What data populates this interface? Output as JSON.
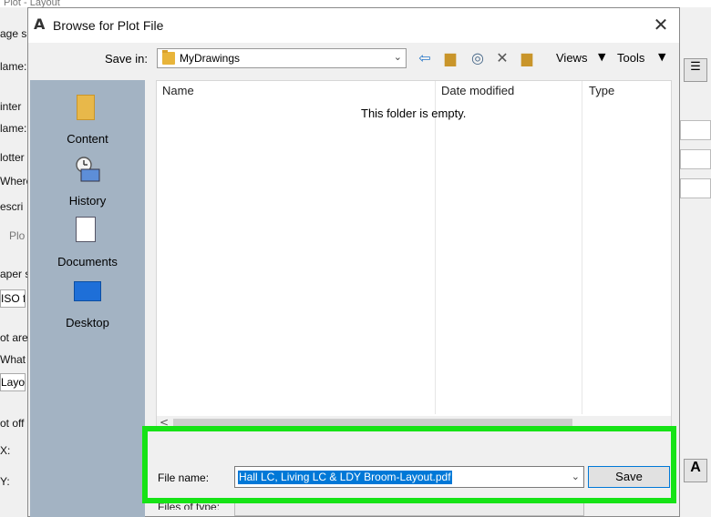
{
  "background_window": {
    "title": "Plot - Layout",
    "left_labels": [
      "age s",
      "lame:",
      "inter",
      "lame:",
      "lotter",
      "Where",
      "escri",
      "Plo",
      "aper s",
      "ISO f",
      "ot are",
      "What",
      "Layou",
      "ot off",
      "X:",
      "Y:"
    ]
  },
  "dialog": {
    "title": "Browse for Plot File",
    "close_symbol": "✕",
    "save_in_label": "Save in:",
    "save_in_value": "MyDrawings",
    "toolbar": {
      "icons": [
        "back-arrow-icon",
        "up-folder-icon",
        "search-web-icon",
        "delete-icon",
        "new-folder-icon"
      ],
      "views_label": "Views",
      "tools_label": "Tools"
    },
    "places": [
      "Content",
      "History",
      "Documents",
      "Desktop"
    ],
    "columns": [
      "Name",
      "Date modified",
      "Type"
    ],
    "empty_message": "This folder is empty.",
    "file_name_label": "File name:",
    "file_name_value": "Hall LC, Living LC & LDY Broom-Layout.pdf",
    "save_button": "Save",
    "files_of_type_label": "Files of type:"
  },
  "colors": {
    "highlight": "#16e316",
    "places_bar": "#a3b3c3",
    "selection": "#0078d7"
  }
}
